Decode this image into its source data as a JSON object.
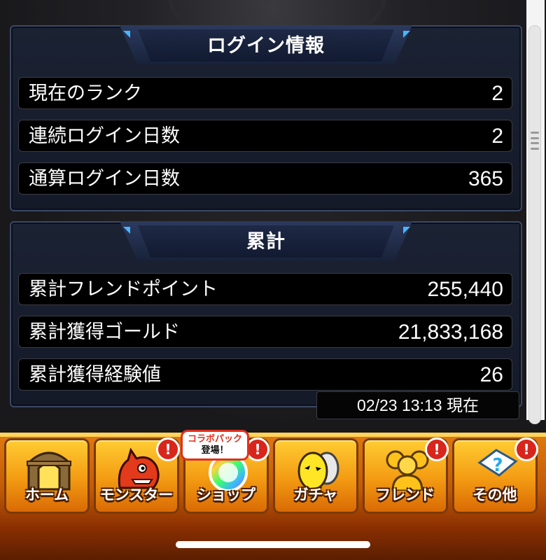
{
  "login_panel": {
    "title": "ログイン情報",
    "rows": [
      {
        "label": "現在のランク",
        "value": "2"
      },
      {
        "label": "連続ログイン日数",
        "value": "2"
      },
      {
        "label": "通算ログイン日数",
        "value": "365"
      }
    ]
  },
  "total_panel": {
    "title": "累計",
    "rows": [
      {
        "label": "累計フレンドポイント",
        "value": "255,440"
      },
      {
        "label": "累計獲得ゴールド",
        "value": "21,833,168"
      },
      {
        "label": "累計獲得経験値",
        "value": "26"
      }
    ]
  },
  "timestamp": "02/23 13:13 現在",
  "nav": {
    "items": [
      {
        "label": "ホーム",
        "icon": "home-gate-icon",
        "alert": false
      },
      {
        "label": "モンスター",
        "icon": "monster-icon",
        "alert": true
      },
      {
        "label": "ショップ",
        "icon": "rainbow-orb-icon",
        "alert": true
      },
      {
        "label": "ガチャ",
        "icon": "egg-icon",
        "alert": false
      },
      {
        "label": "フレンド",
        "icon": "friends-icon",
        "alert": true
      },
      {
        "label": "その他",
        "icon": "question-icon",
        "alert": true
      }
    ],
    "alert_mark": "!",
    "promo_line1": "コラボパック",
    "promo_line2": "登場！"
  },
  "colors": {
    "panel_border": "#3b4866",
    "nav_orange": "#f39a12",
    "alert_red": "#d8261c",
    "accent_blue": "#46b8ff"
  }
}
